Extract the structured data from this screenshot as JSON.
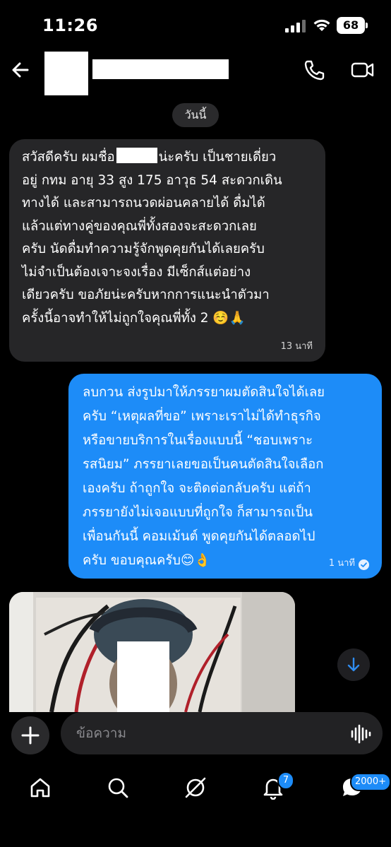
{
  "status_bar": {
    "time": "11:26",
    "battery": "68",
    "icons": [
      "signal-icon",
      "wifi-icon",
      "battery-icon"
    ]
  },
  "header": {
    "icons": [
      "back-arrow-icon",
      "phone-call-icon",
      "video-call-icon"
    ]
  },
  "chat": {
    "date_label": "วันนี้",
    "messages": [
      {
        "direction": "incoming",
        "line1_start": "สวัสดีครับ ผมชื่อ",
        "line1_end": "น่ะครับ เป็นชายเดี่ยว",
        "text": "อยู่ กทม อายุ 33 สูง 175 อาวุธ 54 สะดวกเดิน\nทางได้ และสามารถนวดผ่อนคลายได้ ดื่มได้\nแล้วแต่ทางคู่ของคุณพี่ทั้งสองจะสะดวกเลย\nครับ นัดดื่มทำความรู้จักพูดคุยกันได้เลยครับ\nไม่จำเป็นต้องเจาะจงเรื่อง มีเซ็กส์แต่อย่าง\nเดียวครับ ขอภัยน่ะครับหากการแนะนำตัวมา\nครั้งนี้อาจทำให้ไม่ถูกใจคุณพี่ทั้ง 2 ☺️🙏",
        "time": "13 นาที"
      },
      {
        "direction": "outgoing",
        "text": "ลบกวน ส่งรูปมาให้ภรรยาผมตัดสินใจได้เลย\nครับ “เหตุผลที่ขอ” เพราะเราไม่ได้ทำธุรกิจ\nหรือขายบริการในเรื่องแบบนี้ “ชอบเพราะ\nรสนิยม” ภรรยาเลยขอเป็นคนตัดสินใจเลือก\nเองครับ ถ้าถูกใจ จะติดต่อกลับครับ แต่ถ้า\nภรรยายังไม่เจอแบบที่ถูกใจ ก็สามารถเป็น\nเพื่อนกันนี้ คอมเม้นต์ พูดคุยกันได้ตลอดไป\nครับ ขอบคุณครับ😊👌",
        "time": "1 นาที",
        "status": "seen"
      }
    ]
  },
  "composer": {
    "placeholder": "ข้อความ",
    "icons": [
      "plus-icon",
      "voice-wave-icon"
    ]
  },
  "nav": {
    "notifications_badge": "7",
    "messages_badge": "2000+",
    "icons": [
      "home-icon",
      "search-icon",
      "explore-icon",
      "bell-icon",
      "chat-icon"
    ]
  },
  "colors": {
    "outgoing_bubble": "#1d8cf8",
    "incoming_bubble": "#262628",
    "background": "#000000"
  }
}
